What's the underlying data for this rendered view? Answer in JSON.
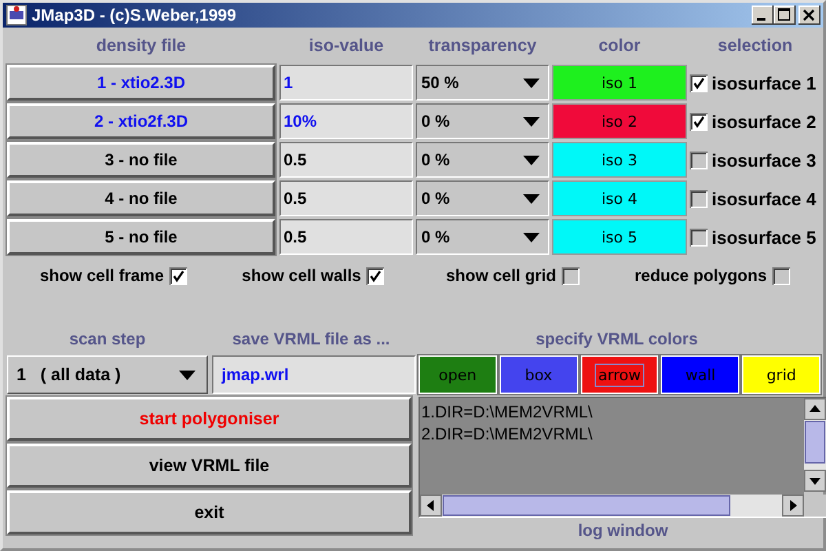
{
  "window": {
    "title": "JMap3D - (c)S.Weber,1999"
  },
  "columns": [
    "density file",
    "iso-value",
    "transparency",
    "color",
    "selection"
  ],
  "surfaces": [
    {
      "file": "1 - xtio2.3D",
      "loaded": true,
      "iso_value": "1",
      "transparency": "50 %",
      "color": "#1ef01e",
      "color_label": "iso 1",
      "label": "isosurface 1",
      "checked": true
    },
    {
      "file": "2 - xtio2f.3D",
      "loaded": true,
      "iso_value": "10%",
      "transparency": "0 %",
      "color": "#f00a3a",
      "color_label": "iso 2",
      "label": "isosurface 2",
      "checked": true
    },
    {
      "file": "3  - no file",
      "loaded": false,
      "iso_value": "0.5",
      "transparency": "0 %",
      "color": "#00f8f8",
      "color_label": "iso 3",
      "label": "isosurface 3",
      "checked": false
    },
    {
      "file": "4  - no file",
      "loaded": false,
      "iso_value": "0.5",
      "transparency": "0 %",
      "color": "#00f8f8",
      "color_label": "iso 4",
      "label": "isosurface 4",
      "checked": false
    },
    {
      "file": "5  - no file",
      "loaded": false,
      "iso_value": "0.5",
      "transparency": "0 %",
      "color": "#00f8f8",
      "color_label": "iso 5",
      "label": "isosurface 5",
      "checked": false
    }
  ],
  "options": [
    {
      "label": "show cell frame",
      "checked": true
    },
    {
      "label": "show cell walls",
      "checked": true
    },
    {
      "label": "show cell grid",
      "checked": false
    },
    {
      "label": "reduce polygons",
      "checked": false
    }
  ],
  "scan_step": {
    "label": "scan step",
    "value": "1   ( all data )"
  },
  "save": {
    "label": "save VRML file as ...",
    "value": "jmap.wrl"
  },
  "vrml_colors": {
    "label": "specify VRML colors",
    "items": [
      {
        "label": "open",
        "color": "#1e7e12",
        "focused": false
      },
      {
        "label": "box",
        "color": "#4444ee",
        "focused": false
      },
      {
        "label": "arrow",
        "color": "#ee1111",
        "focused": true
      },
      {
        "label": "wall",
        "color": "#0000ff",
        "focused": false
      },
      {
        "label": "grid",
        "color": "#ffff00",
        "focused": false
      }
    ]
  },
  "buttons": [
    {
      "label": "start polygoniser",
      "kind": "primary"
    },
    {
      "label": "view VRML file",
      "kind": "normal"
    },
    {
      "label": "exit",
      "kind": "normal"
    }
  ],
  "log": {
    "lines": [
      "1.DIR=D:\\MEM2VRML\\",
      "2.DIR=D:\\MEM2VRML\\"
    ],
    "label": "log window"
  }
}
